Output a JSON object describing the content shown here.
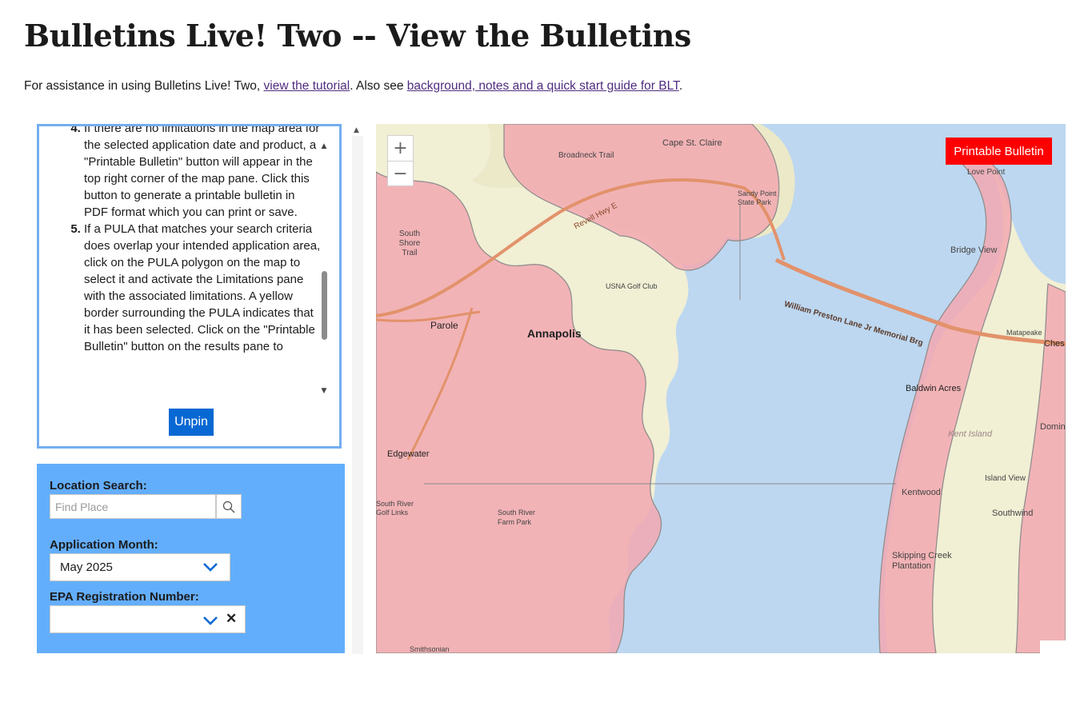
{
  "page": {
    "title": "Bulletins Live! Two -- View the Bulletins",
    "intro": {
      "prefix": "For assistance in using Bulletins Live! Two, ",
      "tutorial_link": "view the tutorial",
      "middle": ". Also see ",
      "background_link": "background, notes and a quick start guide for BLT",
      "suffix": "."
    }
  },
  "instructions": {
    "step4": "If there are no limitations in the map area for the selected application date and product, a \"Printable Bulletin\" button will appear in the top right corner of the map pane. Click this button to generate a printable bulletin in PDF format which you can print or save.",
    "step5": "If a PULA that matches your search criteria does overlap your intended application area, click on the PULA polygon on the map to select it and activate the Limitations pane with the associated limitations. A yellow border surrounding the PULA indicates that it has been selected. Click on the \"Printable Bulletin\" button on the results pane to",
    "unpin_label": "Unpin",
    "scroll_up_icon": "triangle-up-icon",
    "scroll_down_icon": "triangle-down-icon"
  },
  "search": {
    "location_label": "Location Search:",
    "location_placeholder": "Find Place",
    "location_value": "",
    "month_label": "Application Month:",
    "month_value": "May 2025",
    "epa_label": "EPA Registration Number:",
    "epa_value": "",
    "search_icon": "magnifier-icon",
    "colors": {
      "panel_bg": "#63aefc",
      "chevron": "#0868d3"
    }
  },
  "map": {
    "printable_label": "Printable Bulletin",
    "zoom_in": "+",
    "zoom_out": "−",
    "colors": {
      "water": "#bdd7f0",
      "land": "#f1efd4",
      "pula": "#f2a8b0",
      "road": "#e2926b",
      "button": "#ff0000"
    },
    "labels": [
      "Cape St. Claire",
      "Broadneck Trail",
      "Love Point",
      "Revell Hwy E",
      "Sandy Point State Park",
      "South Shore Trail",
      "Bridge View",
      "USNA Golf Club",
      "William Preston Lane Jr Memorial Brg",
      "Parole",
      "Annapolis",
      "Matapeake",
      "Ches",
      "Baldwin Acres",
      "Kent Island",
      "Dominion",
      "Edgewater",
      "Island View",
      "Kentwood",
      "South River Golf Links",
      "South River Farm Park",
      "Southwind",
      "Skipping Creek Plantation",
      "Smithsonian"
    ]
  }
}
